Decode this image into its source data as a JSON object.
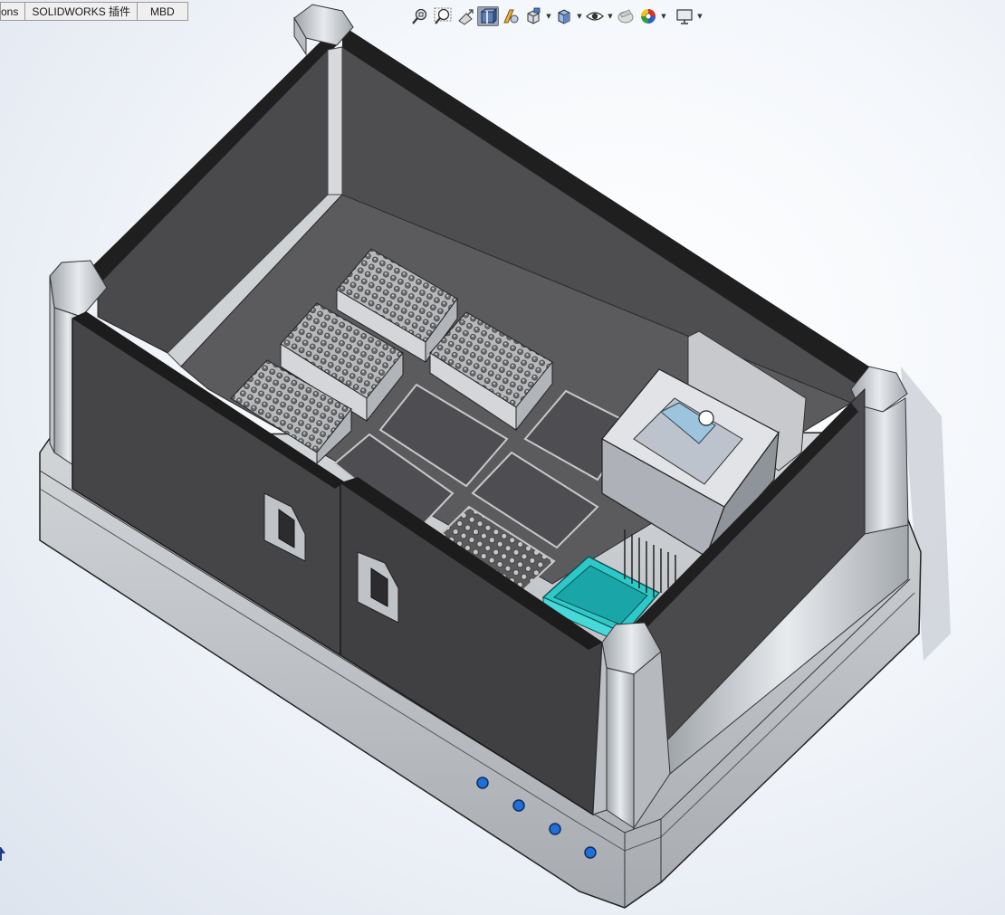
{
  "window": {
    "width": 1110,
    "height": 1011
  },
  "command_tabs": [
    {
      "label": "ons"
    },
    {
      "label": "SOLIDWORKS 插件"
    },
    {
      "label": "MBD"
    }
  ],
  "heads_up_toolbar": [
    {
      "icon": "zoom-to-fit-icon"
    },
    {
      "icon": "zoom-to-area-icon"
    },
    {
      "icon": "previous-view-icon"
    },
    {
      "icon": "section-view-icon",
      "active": true
    },
    {
      "icon": "dynamic-annotation-views-icon"
    },
    {
      "icon": "view-orientation-icon",
      "dropdown": true
    },
    {
      "icon": "display-style-icon",
      "dropdown": true
    },
    {
      "icon": "hide-show-items-icon",
      "dropdown": true
    },
    {
      "icon": "edit-appearance-icon"
    },
    {
      "icon": "apply-scene-icon",
      "dropdown": true
    },
    {
      "icon": "view-settings-icon",
      "dropdown": true
    }
  ],
  "colors": {
    "enclosure_panel": "#4a4a4a",
    "enclosure_edge": "#1f1f1f",
    "frame_metal": "#c8ccd0",
    "deck": "#5a5a5c",
    "reservoir": "#2ec8c8",
    "status_led": "#1f6fd6"
  }
}
